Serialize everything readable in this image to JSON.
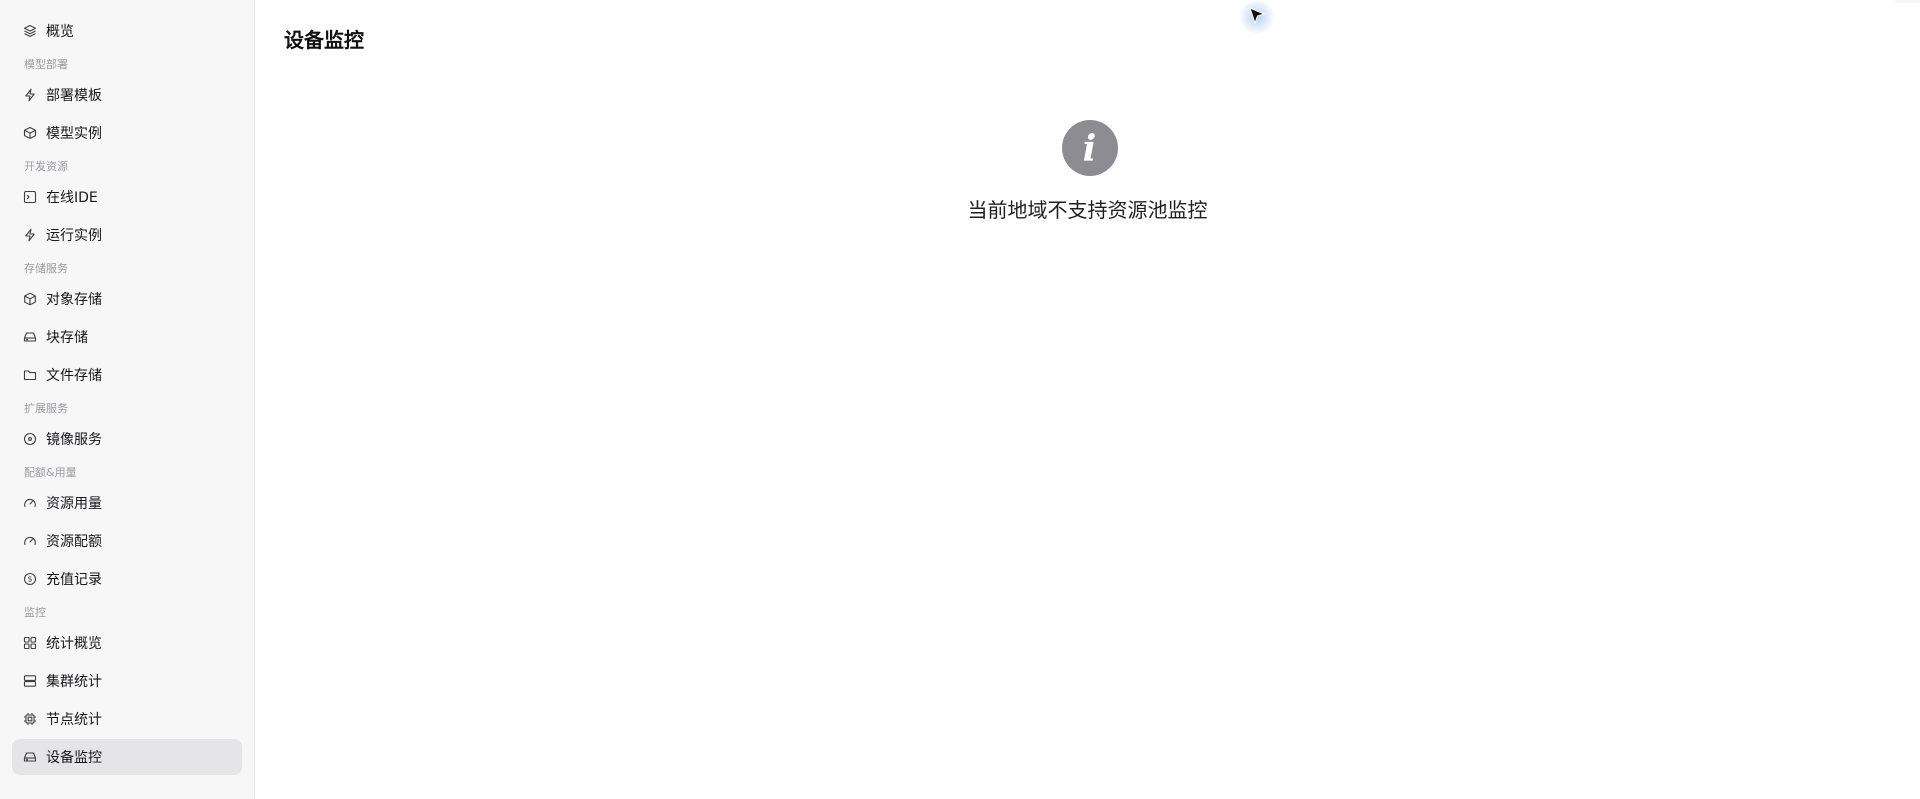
{
  "sidebar": {
    "items": [
      {
        "type": "item",
        "label": "概览",
        "icon": "layers-icon"
      },
      {
        "type": "section",
        "label": "模型部署"
      },
      {
        "type": "item",
        "label": "部署模板",
        "icon": "bolt-icon"
      },
      {
        "type": "item",
        "label": "模型实例",
        "icon": "stack-icon"
      },
      {
        "type": "section",
        "label": "开发资源"
      },
      {
        "type": "item",
        "label": "在线IDE",
        "icon": "terminal-icon"
      },
      {
        "type": "item",
        "label": "运行实例",
        "icon": "bolt-icon"
      },
      {
        "type": "section",
        "label": "存储服务"
      },
      {
        "type": "item",
        "label": "对象存储",
        "icon": "cube-icon"
      },
      {
        "type": "item",
        "label": "块存储",
        "icon": "drive-icon"
      },
      {
        "type": "item",
        "label": "文件存储",
        "icon": "folder-icon"
      },
      {
        "type": "section",
        "label": "扩展服务"
      },
      {
        "type": "item",
        "label": "镜像服务",
        "icon": "disc-icon"
      },
      {
        "type": "section",
        "label": "配额&用量"
      },
      {
        "type": "item",
        "label": "资源用量",
        "icon": "gauge-icon"
      },
      {
        "type": "item",
        "label": "资源配额",
        "icon": "gauge-icon"
      },
      {
        "type": "item",
        "label": "充值记录",
        "icon": "dollar-circle-icon"
      },
      {
        "type": "section",
        "label": "监控"
      },
      {
        "type": "item",
        "label": "统计概览",
        "icon": "grid-icon"
      },
      {
        "type": "item",
        "label": "集群统计",
        "icon": "server-icon"
      },
      {
        "type": "item",
        "label": "节点统计",
        "icon": "chip-icon"
      },
      {
        "type": "item",
        "label": "设备监控",
        "icon": "drive-icon",
        "active": true
      }
    ]
  },
  "main": {
    "title": "设备监控",
    "empty_state": {
      "icon": "info-icon",
      "glyph": "i",
      "message": "当前地域不支持资源池监控"
    }
  }
}
